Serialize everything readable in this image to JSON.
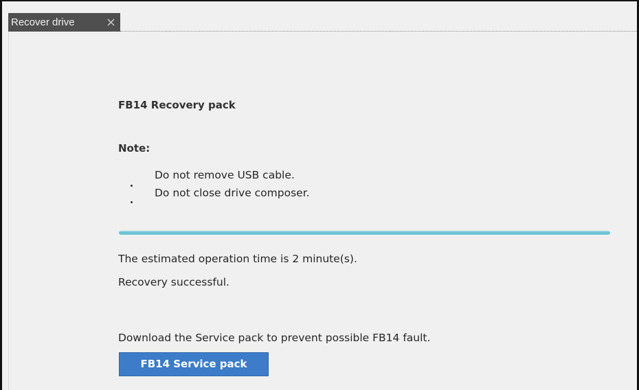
{
  "tab": {
    "label": "Recover drive",
    "close_glyph": "✕"
  },
  "recovery": {
    "title": "FB14 Recovery pack",
    "note_label": "Note:",
    "notes": [
      "Do not remove USB cable.",
      "Do not close drive composer."
    ],
    "progress": 1.0,
    "estimate_text": "The estimated operation time is 2 minute(s).",
    "status_text": "Recovery successful."
  },
  "service": {
    "prompt": "Download the Service pack to prevent possible FB14 fault.",
    "button_label": "FB14 Service pack"
  },
  "colors": {
    "tab_bg": "#4f4f4f",
    "button_bg": "#3c7cc8",
    "progress": "#5fbccf",
    "panel_bg": "#f0f0f0"
  },
  "icons": {
    "tab_close": "close-icon",
    "list_bullet": "bullet-dot"
  }
}
